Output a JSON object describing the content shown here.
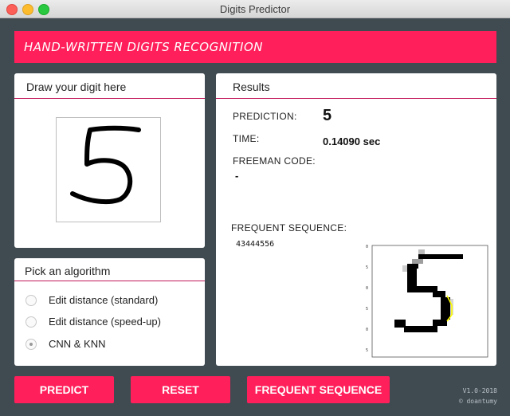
{
  "window": {
    "title": "Digits Predictor"
  },
  "banner": {
    "title": "HAND-WRITTEN DIGITS RECOGNITION"
  },
  "draw_panel": {
    "title": "Draw your digit here",
    "drawn_digit": "5"
  },
  "algorithm_panel": {
    "title": "Pick an algorithm",
    "options": [
      {
        "label": "Edit distance (standard)",
        "selected": false
      },
      {
        "label": "Edit distance (speed-up)",
        "selected": false
      },
      {
        "label": "CNN & KNN",
        "selected": true
      }
    ]
  },
  "results_panel": {
    "title": "Results",
    "prediction_label": "PREDICTION:",
    "prediction_value": "5",
    "time_label": "TIME:",
    "time_value": "0.14090 sec",
    "freeman_label": "FREEMAN CODE:",
    "freeman_value": "-",
    "frequent_label": "FREQUENT SEQUENCE:",
    "frequent_value": "43444556",
    "plot_ticks": [
      "0",
      "5",
      "0",
      "5",
      "0",
      "5",
      "0",
      "5"
    ],
    "highlight_color": "#ffff00"
  },
  "buttons": {
    "predict": "PREDICT",
    "reset": "RESET",
    "frequent": "FREQUENT SEQUENCE"
  },
  "footer": {
    "version": "V1.0-2018",
    "author": "© doantumy"
  },
  "colors": {
    "accent": "#ff1f5a",
    "background": "#3f4a51",
    "panel_underline": "#c2185b"
  }
}
